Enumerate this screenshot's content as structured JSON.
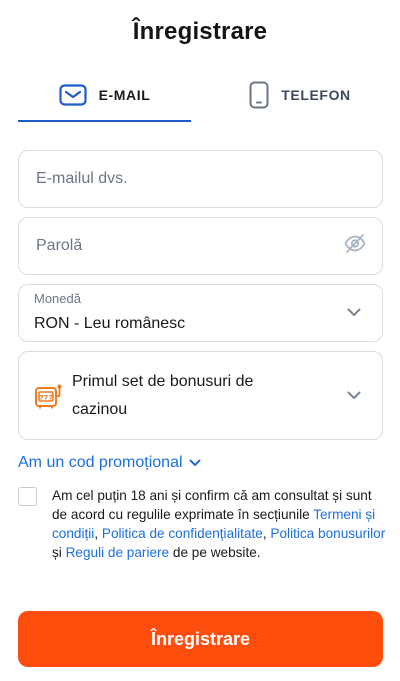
{
  "page": {
    "title": "Înregistrare"
  },
  "tabs": {
    "email": {
      "label": "E-MAIL",
      "icon": "envelope-icon",
      "active": true
    },
    "phone": {
      "label": "TELEFON",
      "icon": "phone-icon",
      "active": false
    }
  },
  "form": {
    "email": {
      "value": "",
      "placeholder": "E-mailul dvs."
    },
    "password": {
      "value": "",
      "placeholder": "Parolă",
      "toggle_icon": "eye-off-icon"
    },
    "currency": {
      "label": "Monedă",
      "value": "RON - Leu românesc",
      "icon": "chevron-down-icon"
    },
    "bonus": {
      "value": "Primul set de bonusuri de cazinou",
      "icon": "slot-machine-icon"
    },
    "promo_link": "Am un cod promoțional",
    "terms": {
      "checked": false,
      "text_1": "Am cel puțin 18 ani și confirm că am consultat și sunt de acord cu regulile exprimate în secțiunile ",
      "link_terms": "Termeni și condiții",
      "sep_1": ", ",
      "link_privacy": "Politica de confidențialitate",
      "sep_2": ", ",
      "link_bonus": "Politica bonusurilor",
      "sep_3": " și ",
      "link_betting": "Reguli de pariere",
      "text_2": " de pe website."
    },
    "submit_label": "Înregistrare"
  },
  "colors": {
    "accent_blue": "#1e5bc6",
    "link_blue": "#1d6fe0",
    "submit_orange": "#ff4d0d",
    "slot_icon_orange": "#f07a1e",
    "border_gray": "#d9dde3"
  }
}
